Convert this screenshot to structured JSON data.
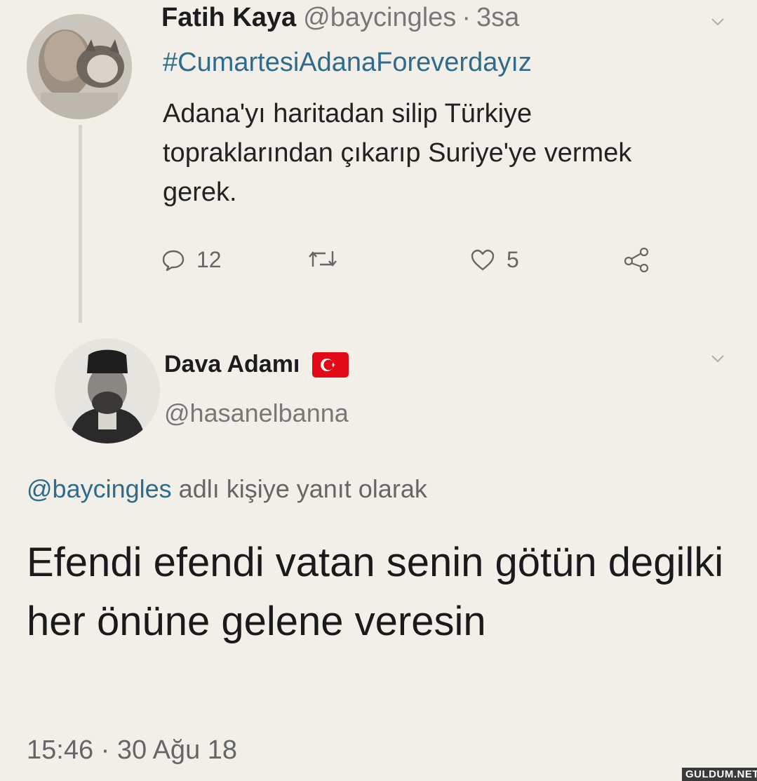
{
  "tweet1": {
    "name": "Fatih Kaya",
    "handle": "@baycingles",
    "separator": "·",
    "time": "3sa",
    "hashtag": "#CumartesiAdanaForeverdayız",
    "body": "Adana'yı haritadan silip Türkiye topraklarından çıkarıp Suriye'ye vermek gerek.",
    "replies": "12",
    "likes": "5",
    "icons": {
      "reply": "reply-icon",
      "retweet": "retweet-icon",
      "like": "heart-icon",
      "share": "share-icon",
      "menu": "chevron-down-icon"
    }
  },
  "tweet2": {
    "name": "Dava Adamı",
    "handle": "@hasanelbanna",
    "reply_to_mention": "@baycingles",
    "reply_to_suffix": "adlı kişiye yanıt olarak",
    "body": "Efendi efendi vatan senin götün degilki her önüne gelene veresin",
    "timestamp": "15:46 · 30 Ağu 18",
    "icons": {
      "flag": "turkish-flag-icon",
      "menu": "chevron-down-icon"
    }
  },
  "watermark": "GULDUM.NET",
  "colors": {
    "background": "#f1efe8",
    "link": "#2f6b8d",
    "muted": "#777777",
    "flag_red": "#e30a17"
  }
}
